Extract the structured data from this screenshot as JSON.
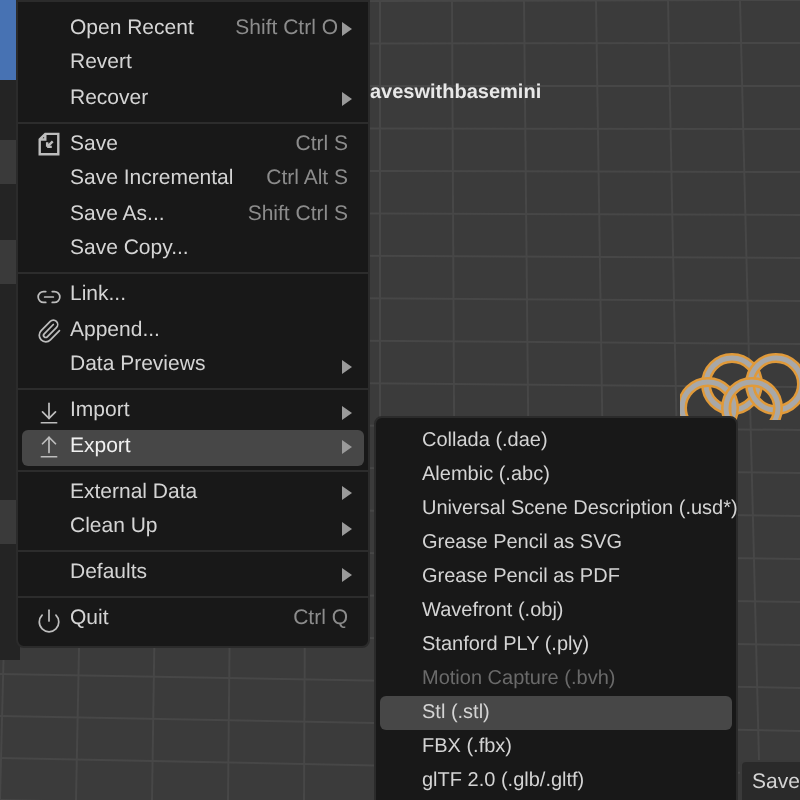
{
  "viewport": {
    "object_label": "aveswithbasemini"
  },
  "file_menu": {
    "groups": [
      {
        "items": [
          {
            "label": "Open Recent",
            "shortcut": "Shift Ctrl O",
            "submenu": true,
            "selected": false
          },
          {
            "label": "Revert",
            "submenu": false,
            "selected": false
          },
          {
            "label": "Recover",
            "submenu": true,
            "selected": false
          }
        ]
      },
      {
        "items": [
          {
            "label": "Save",
            "shortcut": "Ctrl S",
            "submenu": false,
            "selected": false
          },
          {
            "label": "Save Incremental",
            "shortcut": "Ctrl Alt S",
            "submenu": false,
            "selected": false
          },
          {
            "label": "Save As...",
            "shortcut": "Shift Ctrl S",
            "submenu": false,
            "selected": false
          },
          {
            "label": "Save Copy...",
            "submenu": false,
            "selected": false
          }
        ]
      },
      {
        "items": [
          {
            "label": "Link...",
            "submenu": false,
            "selected": false
          },
          {
            "label": "Append...",
            "submenu": false,
            "selected": false
          },
          {
            "label": "Data Previews",
            "submenu": true,
            "selected": false
          }
        ]
      },
      {
        "items": [
          {
            "label": "Import",
            "submenu": true,
            "selected": false
          },
          {
            "label": "Export",
            "submenu": true,
            "selected": true
          }
        ]
      },
      {
        "items": [
          {
            "label": "External Data",
            "submenu": true,
            "selected": false
          },
          {
            "label": "Clean Up",
            "submenu": true,
            "selected": false
          }
        ]
      },
      {
        "items": [
          {
            "label": "Defaults",
            "submenu": true,
            "selected": false
          }
        ]
      },
      {
        "items": [
          {
            "label": "Quit",
            "shortcut": "Ctrl Q",
            "submenu": false,
            "selected": false
          }
        ]
      }
    ]
  },
  "export_menu": {
    "items": [
      {
        "label": "Collada (.dae)",
        "selected": false,
        "disabled": false
      },
      {
        "label": "Alembic (.abc)",
        "selected": false,
        "disabled": false
      },
      {
        "label": "Universal Scene Description (.usd*)",
        "selected": false,
        "disabled": false
      },
      {
        "label": "Grease Pencil as SVG",
        "selected": false,
        "disabled": false
      },
      {
        "label": "Grease Pencil as PDF",
        "selected": false,
        "disabled": false
      },
      {
        "label": "Wavefront (.obj)",
        "selected": false,
        "disabled": false
      },
      {
        "label": "Stanford PLY (.ply)",
        "selected": false,
        "disabled": false
      },
      {
        "label": "Motion Capture (.bvh)",
        "selected": false,
        "disabled": true
      },
      {
        "label": "Stl (.stl)",
        "selected": true,
        "disabled": false
      },
      {
        "label": "FBX (.fbx)",
        "selected": false,
        "disabled": false
      },
      {
        "label": "glTF 2.0 (.glb/.gltf)",
        "selected": false,
        "disabled": false
      }
    ]
  },
  "save_button": {
    "label": "Save"
  }
}
